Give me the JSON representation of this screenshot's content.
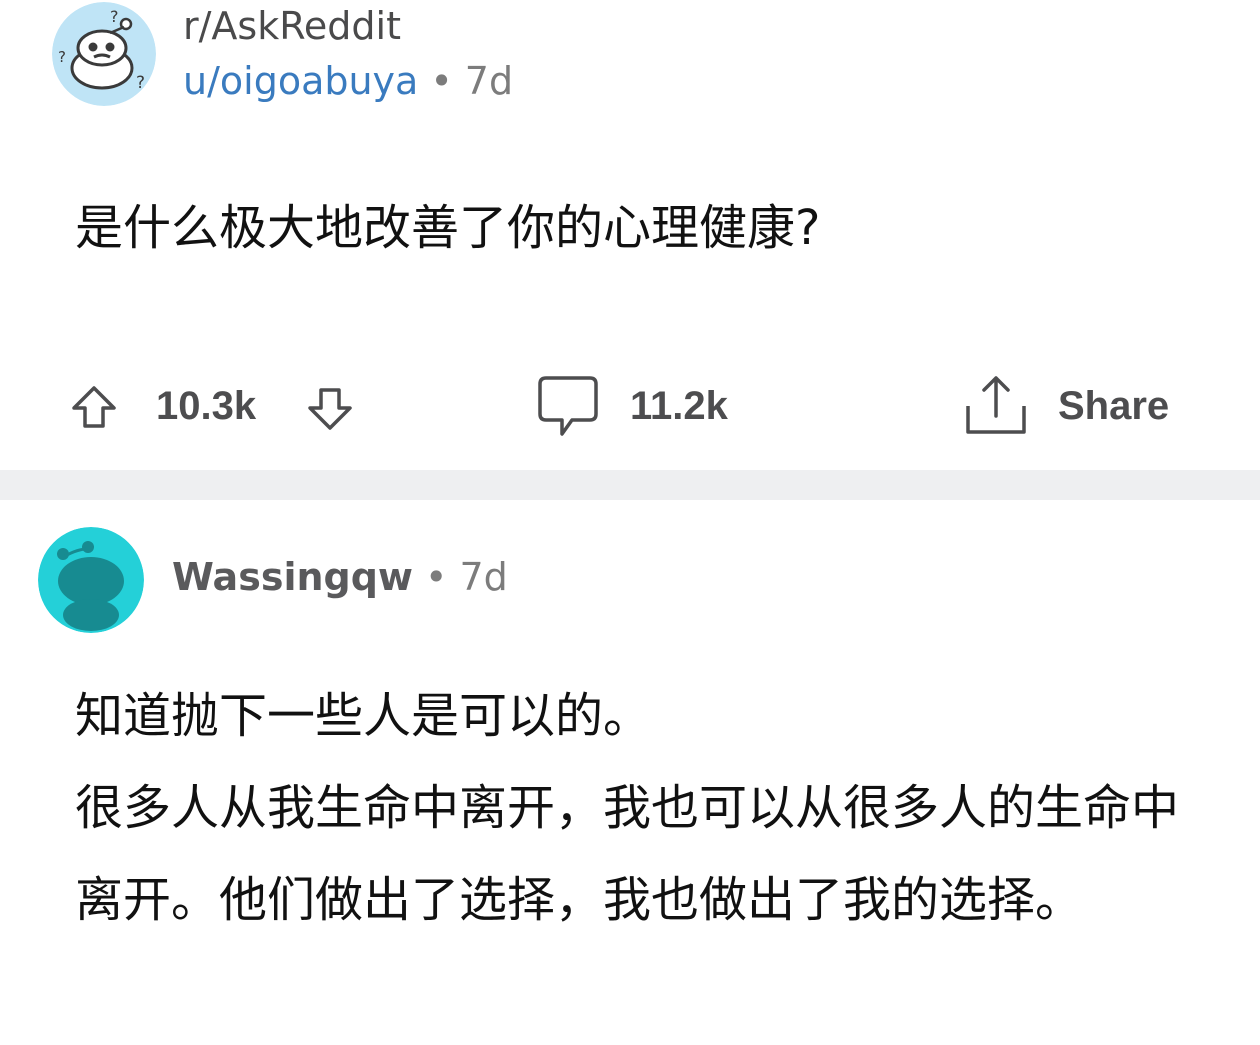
{
  "post": {
    "subreddit": "r/AskReddit",
    "username": "u/oigoabuya",
    "separator": "•",
    "age": "7d",
    "title": "是什么极大地改善了你的心理健康?",
    "upvotes": "10.3k",
    "comments": "11.2k",
    "share_label": "Share"
  },
  "comment": {
    "author": "Wassingqw",
    "separator": "•",
    "age": "7d",
    "paragraphs": [
      "知道抛下一些人是可以的。",
      "很多人从我生命中离开，我也可以从很多人的生命中离开。他们做出了选择，我也做出了我的选择。"
    ]
  },
  "colors": {
    "username_link": "#3a7bbf",
    "muted_text": "#7c7c7c",
    "divider": "#eeeff1",
    "comment_avatar_bg": "#24d0d8"
  },
  "icons": {
    "post_avatar": "snoo-confused-icon",
    "comment_avatar": "snoo-avatar-icon",
    "upvote": "upvote-arrow-icon",
    "downvote": "downvote-arrow-icon",
    "comment": "comment-bubble-icon",
    "share": "share-icon"
  }
}
